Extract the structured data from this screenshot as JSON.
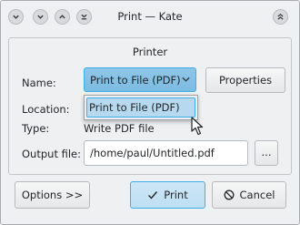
{
  "window": {
    "title": "Print — Kate"
  },
  "titlebar": {
    "buttons": [
      "menu-icon",
      "minimize-icon",
      "maximize-icon",
      "keep-below-icon",
      "close-icon"
    ]
  },
  "printer_group": {
    "title": "Printer",
    "name_label": "Name:",
    "name_value": "Print to File (PDF)",
    "dropdown_options": [
      "Print to File (PDF)"
    ],
    "properties_label": "Properties",
    "location_label": "Location:",
    "type_label": "Type:",
    "type_value": "Write PDF file",
    "output_label": "Output file:",
    "output_value": "/home/paul/Untitled.pdf",
    "browse_label": "..."
  },
  "footer": {
    "options_label": "Options >>",
    "print_label": "Print",
    "cancel_label": "Cancel"
  },
  "colors": {
    "accent": "#3daee9",
    "window_bg": "#eff0f1"
  }
}
